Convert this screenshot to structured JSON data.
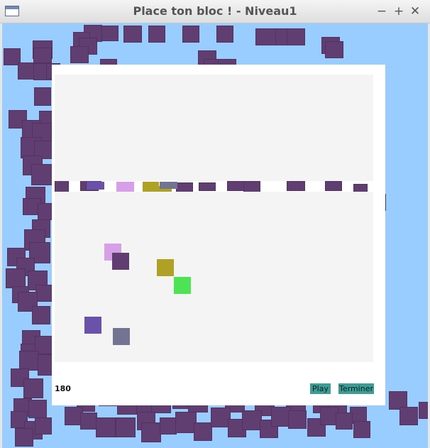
{
  "window": {
    "title": "Place ton bloc ! - Niveau1"
  },
  "window_controls": {
    "minimize": "−",
    "maximize": "+",
    "close": "✕"
  },
  "game": {
    "score": "180",
    "play_label": "Play",
    "finish_label": "Terminer"
  },
  "colors": {
    "sky": "#99ccff",
    "background_block": "#613e71",
    "panel": "#f4f4f4",
    "frame": "#ffffff",
    "block_pink": "#d79fe8",
    "block_purple": "#613e71",
    "block_olive": "#afa123",
    "block_green": "#4ee354",
    "block_blue": "#6a52ab",
    "block_gray": "#737392",
    "button": "#3d9d96"
  }
}
